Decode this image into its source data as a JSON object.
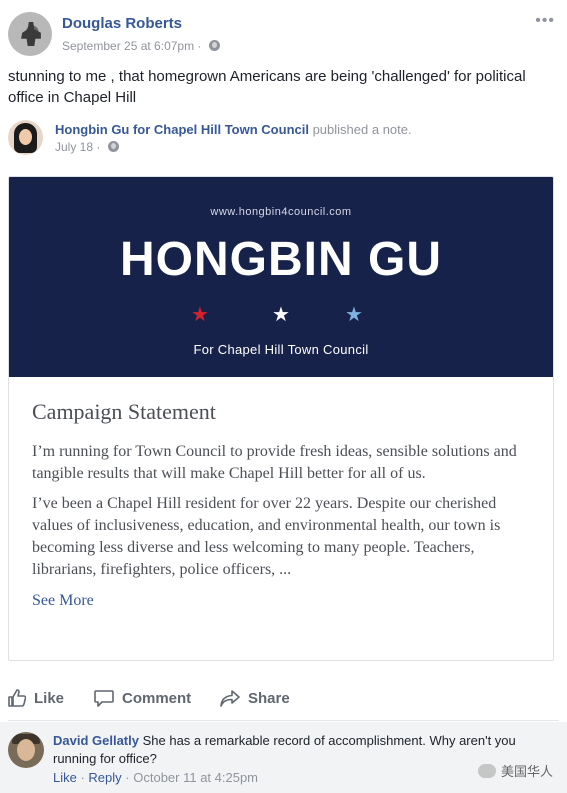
{
  "post": {
    "author": "Douglas Roberts",
    "timestamp": "September 25 at 6:07pm",
    "privacy_icon": "globe-icon",
    "more_icon": "•••",
    "text": "stunning to me , that homegrown Americans are being 'challenged' for political office in Chapel Hill"
  },
  "shared": {
    "author": "Hongbin Gu for Chapel Hill Town Council",
    "action": " published a note.",
    "timestamp": "July 18 · "
  },
  "note": {
    "banner": {
      "url": "www.hongbin4council.com",
      "title": "HONGBIN GU",
      "stars": [
        "★",
        "★",
        "★"
      ],
      "subtitle": "For Chapel Hill Town Council",
      "background": "#17224a"
    },
    "title": "Campaign Statement",
    "paragraph1": "I’m running for Town Council to provide fresh ideas, sensible solutions and tangible results that will make Chapel Hill better for all of us.",
    "paragraph2": "I’ve been a Chapel Hill resident for over 22 years. Despite our cherished values of inclusiveness, education, and environmental health, our town is becoming less diverse and less welcoming to many people. Teachers, librarians, firefighters, police officers, ...",
    "see_more": "See More"
  },
  "actions": {
    "like": "Like",
    "comment": "Comment",
    "share": "Share"
  },
  "comment": {
    "author": "David Gellatly",
    "text": " She has a remarkable record of accomplishment. Why aren't you running for office?",
    "like": "Like",
    "separator": " · ",
    "reply": "Reply",
    "timestamp": "October 11 at 4:25pm"
  },
  "watermark": "美国华人",
  "colors": {
    "link": "#365899",
    "meta": "#90949c",
    "banner": "#17224a",
    "star_red": "#d2222e",
    "star_blue": "#7fb1e0"
  }
}
